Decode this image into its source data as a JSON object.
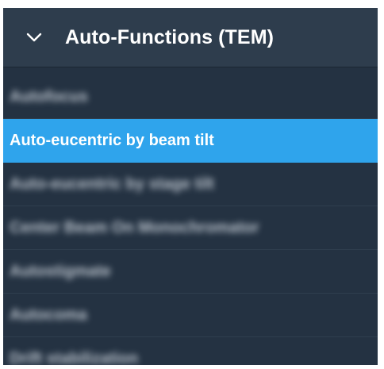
{
  "panel": {
    "header": {
      "title": "Auto-Functions (TEM)",
      "expand_icon": "chevron-down-icon"
    },
    "items": [
      {
        "label": "Autofocus",
        "selected": false,
        "blurred": true
      },
      {
        "label": "Auto-eucentric by beam tilt",
        "selected": true,
        "blurred": false
      },
      {
        "label": "Auto-eucentric by stage tilt",
        "selected": false,
        "blurred": true
      },
      {
        "label": "Center Beam On Monochromator",
        "selected": false,
        "blurred": true
      },
      {
        "label": "Autostigmate",
        "selected": false,
        "blurred": true
      },
      {
        "label": "Autocoma",
        "selected": false,
        "blurred": true
      },
      {
        "label": "Drift stabilization",
        "selected": false,
        "blurred": true
      }
    ]
  },
  "colors": {
    "panel_bg": "#243242",
    "header_bg": "#2e3d4d",
    "selected_bg": "#2fa4ec",
    "text": "#d4dbe3"
  }
}
